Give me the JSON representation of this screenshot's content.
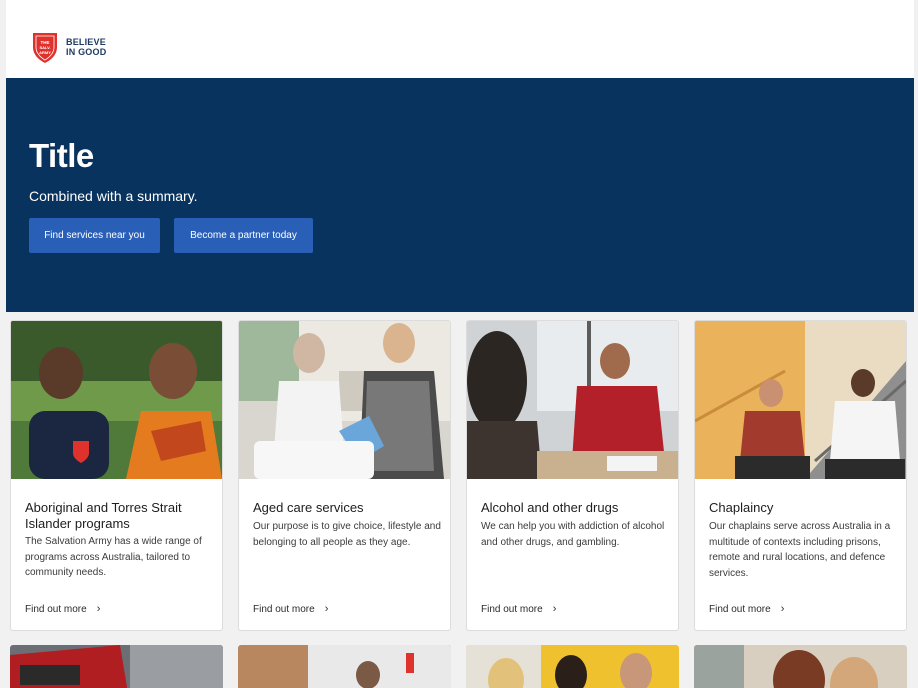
{
  "brand": {
    "logo_line1": "BELIEVE",
    "logo_line2": "IN GOOD",
    "shield_text": "THE SALVATION ARMY",
    "colors": {
      "navy": "#07335e",
      "button": "#2a5fb8",
      "shield_red": "#e0322d"
    }
  },
  "hero": {
    "title": "Title",
    "summary": "Combined with a summary.",
    "primary_button": "Find services near you",
    "secondary_button": "Become a partner today"
  },
  "cards": [
    {
      "title": "Aboriginal and Torres Strait Islander programs",
      "description": "The Salvation Army has a wide range of programs across Australia, tailored to community needs.",
      "link": "Find out more"
    },
    {
      "title": "Aged care services",
      "description": "Our purpose is to give choice, lifestyle and belonging to all people as they age.",
      "link": "Find out more"
    },
    {
      "title": "Alcohol and other drugs",
      "description": "We can help you with addiction of alcohol and other drugs, and gambling.",
      "link": "Find out more"
    },
    {
      "title": "Chaplaincy",
      "description": "Our chaplains serve across Australia in a multitude of contexts including prisons, remote and rural locations, and defence services.",
      "link": "Find out more"
    }
  ],
  "icons": {
    "chevron": "chevron-right-icon"
  }
}
